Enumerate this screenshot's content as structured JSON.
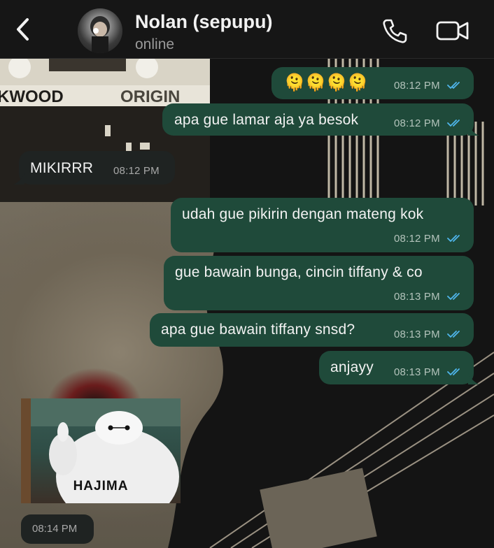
{
  "header": {
    "contact_name": "Nolan (sepupu)",
    "status": "online",
    "icons": [
      "back-chevron-icon",
      "phone-icon",
      "video-camera-icon"
    ]
  },
  "messages": [
    {
      "dir": "out",
      "text": "🫠🫠🫠🫠",
      "time": "08:12 PM",
      "read": true
    },
    {
      "dir": "out",
      "text": "apa gue lamar aja ya besok",
      "time": "08:12 PM",
      "read": true
    },
    {
      "dir": "in",
      "text": "MIKIRRR",
      "time": "08:12 PM"
    },
    {
      "dir": "out",
      "text": "udah gue pikirin dengan mateng kok",
      "time": "08:12 PM",
      "read": true
    },
    {
      "dir": "out",
      "text": "gue bawain bunga, cincin tiffany & co",
      "time": "08:13 PM",
      "read": true
    },
    {
      "dir": "out",
      "text": "apa gue bawain tiffany snsd?",
      "time": "08:13 PM",
      "read": true
    },
    {
      "dir": "out",
      "text": "anjayy",
      "time": "08:13 PM",
      "read": true
    },
    {
      "dir": "in",
      "type": "image",
      "caption": "HAJIMA",
      "time": "08:14 PM"
    }
  ],
  "wallpaper_text": [
    "KWOOD",
    "ORIGIN"
  ],
  "colors": {
    "outgoing_bubble": "#1f4a3a",
    "incoming_bubble": "#1f2322",
    "read_ticks": "#4fb6ec",
    "header_bg": "#161616"
  }
}
